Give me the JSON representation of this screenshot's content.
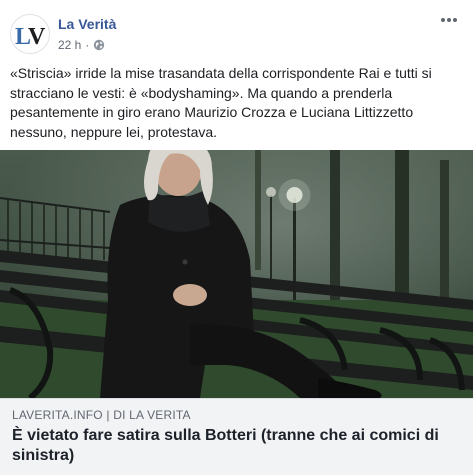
{
  "post": {
    "page_name": "La Verità",
    "avatar_text": "LV",
    "timestamp": "22 h",
    "separator": "·",
    "more_icon": "more-horizontal-icon",
    "privacy_icon": "globe-icon",
    "text": "«Striscia» irride la mise trasandata della corrispondente Rai e tutti si stracciano le vesti: è «bodyshaming». Ma quando a prenderla pesantemente in giro erano Maurizio Crozza e Luciana Littizzetto nessuno, neppure lei, protestava."
  },
  "link_preview": {
    "domain": "LAVERITA.INFO | DI LA VERITA",
    "title": "È vietato fare satira sulla Botteri (tranne che ai comici di sinistra)"
  },
  "colors": {
    "page_name": "#385898",
    "meta_text": "#616770",
    "card_bg": "#f2f3f5",
    "avatar_blue": "#3b6aa8"
  }
}
